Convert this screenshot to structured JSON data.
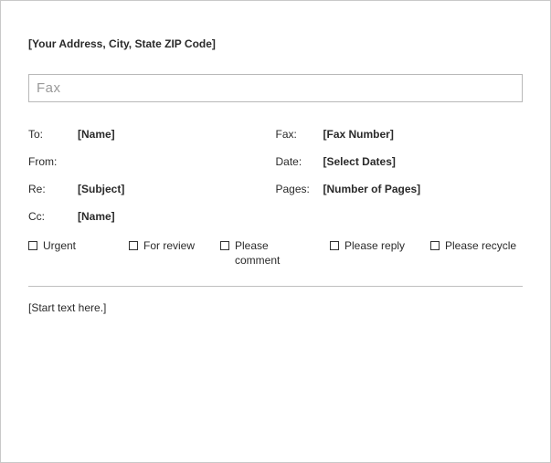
{
  "header": {
    "address": "[Your Address, City, State  ZIP Code]"
  },
  "title": {
    "fax": "Fax"
  },
  "fields": {
    "to_label": "To:",
    "to_value": "[Name]",
    "from_label": "From:",
    "from_value": "",
    "re_label": "Re:",
    "re_value": "[Subject]",
    "cc_label": "Cc:",
    "cc_value": "[Name]",
    "fax_label": "Fax:",
    "fax_value": "[Fax Number]",
    "date_label": "Date:",
    "date_value": "[Select Dates]",
    "pages_label": "Pages:",
    "pages_value": "[Number of Pages]"
  },
  "options": {
    "urgent": "Urgent",
    "for_review": "For review",
    "please_comment": "Please comment",
    "please_reply": "Please reply",
    "please_recycle": "Please recycle"
  },
  "body": {
    "start": "[Start text here.]"
  }
}
